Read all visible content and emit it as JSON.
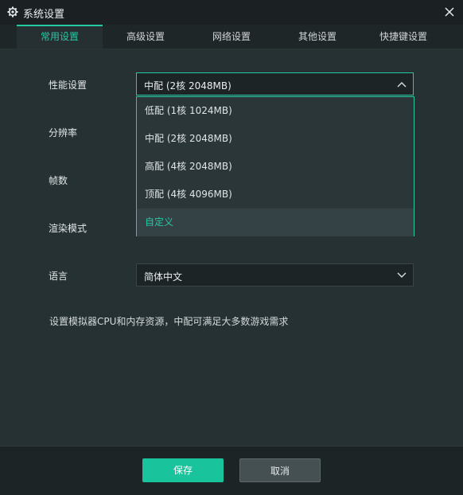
{
  "window": {
    "title": "系统设置",
    "icon": "gear-icon",
    "close_icon": "close-icon"
  },
  "tabs": [
    {
      "label": "常用设置",
      "active": true
    },
    {
      "label": "高级设置",
      "active": false
    },
    {
      "label": "网络设置",
      "active": false
    },
    {
      "label": "其他设置",
      "active": false
    },
    {
      "label": "快捷键设置",
      "active": false
    }
  ],
  "settings": {
    "performance": {
      "label": "性能设置",
      "value": "中配 (2核 2048MB)",
      "options": [
        "低配 (1核 1024MB)",
        "中配 (2核 2048MB)",
        "高配 (4核 2048MB)",
        "顶配 (4核 4096MB)",
        "自定义"
      ]
    },
    "resolution": {
      "label": "分辨率"
    },
    "fps": {
      "label": "帧数"
    },
    "render_mode": {
      "label": "渲染模式"
    },
    "language": {
      "label": "语言",
      "value": "简体中文"
    }
  },
  "hint": "设置模拟器CPU和内存资源，中配可满足大多数游戏需求",
  "buttons": {
    "save": "保存",
    "cancel": "取消"
  },
  "colors": {
    "accent": "#27c9a3",
    "background": "#263133",
    "save_button": "#19c39c"
  }
}
